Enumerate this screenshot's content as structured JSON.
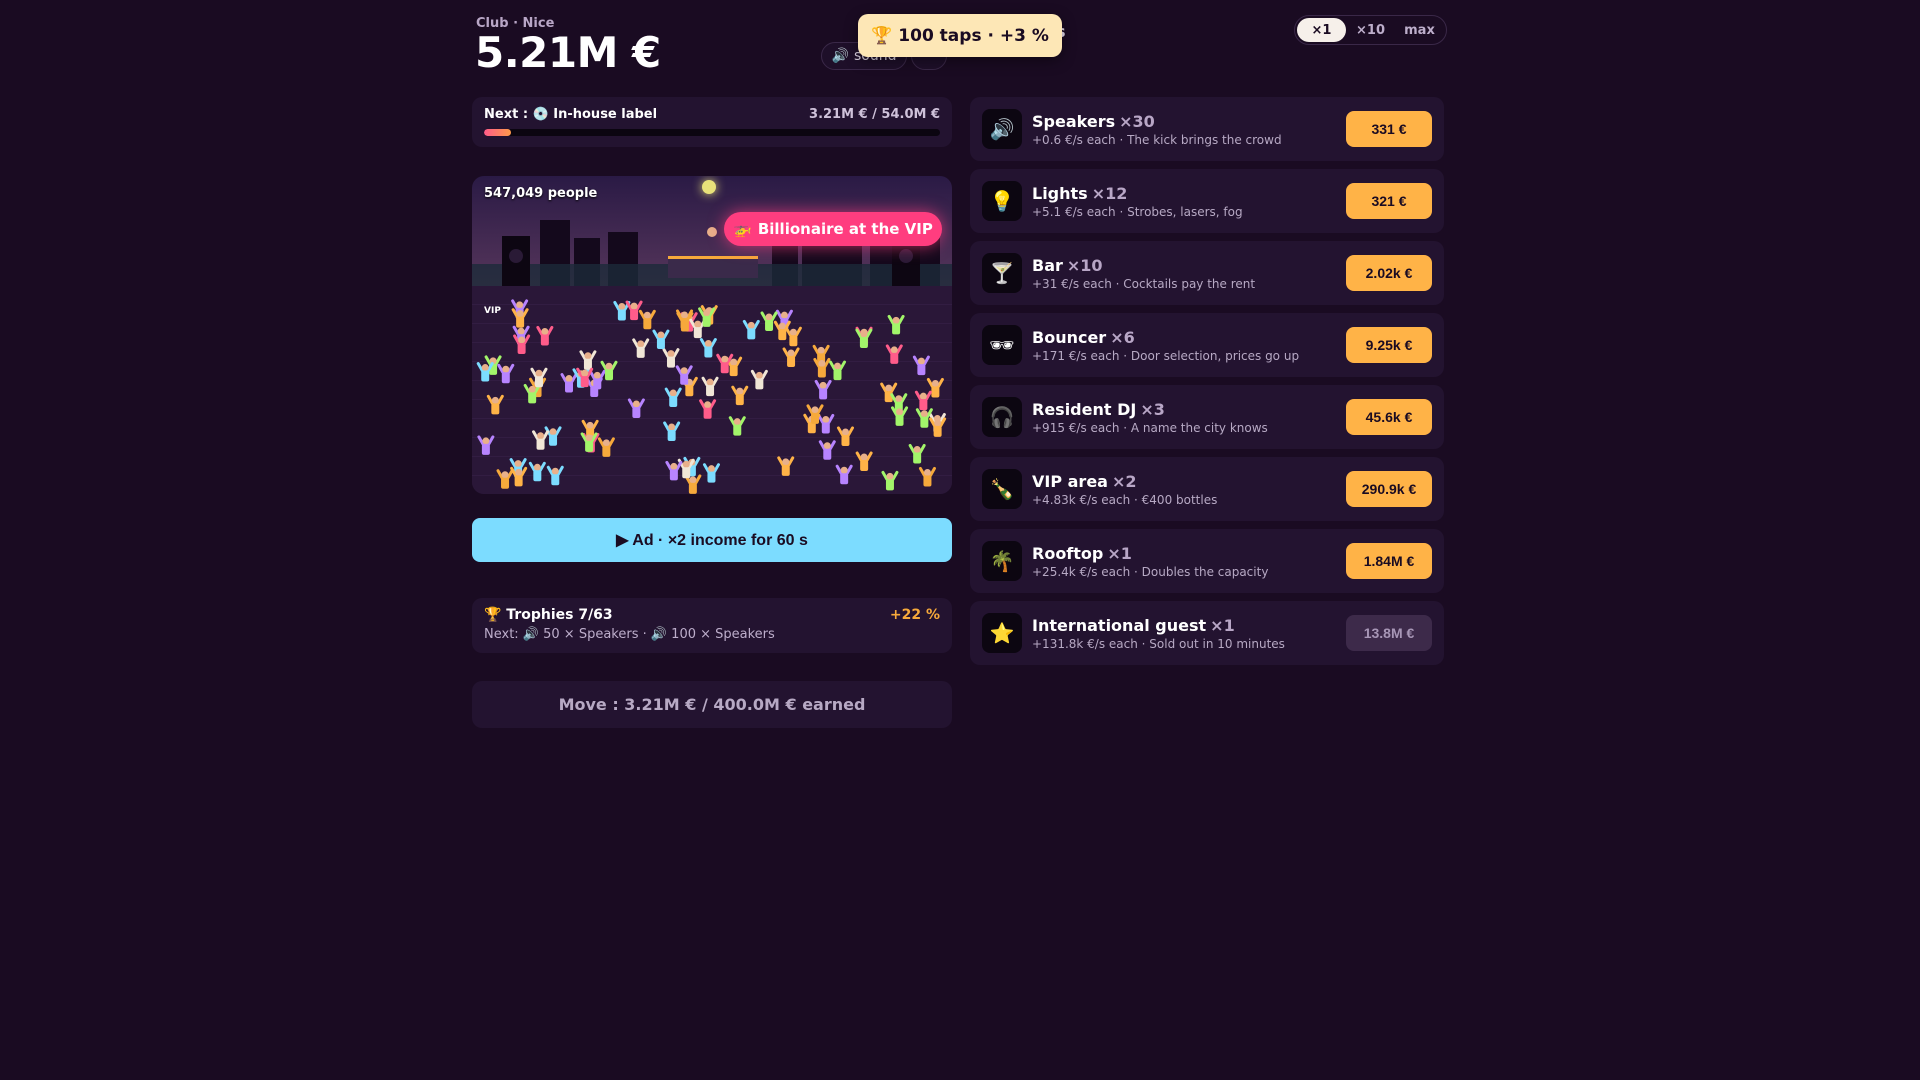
{
  "header": {
    "club": "Club · Nice",
    "money": "5.21M €",
    "sound_icon": "🔊",
    "sound_label": "sound",
    "more_label": "···",
    "toast_icon": "🏆",
    "toast_text": "100 taps · +3 %",
    "toast_edge": "s"
  },
  "multiplier": {
    "options": [
      "×1",
      "×10",
      "max"
    ],
    "active": "×1"
  },
  "next": {
    "label": "Next : 💿 In-house label",
    "amount": "3.21M € / 54.0M €",
    "progress": 0.06
  },
  "scene": {
    "people": "547,049 people",
    "event_icon": "🚁",
    "event": "Billionaire at the VIP",
    "vip": "VIP"
  },
  "ad": {
    "label": "▶ Ad · ×2 income for 60 s"
  },
  "trophies": {
    "title": "🏆 Trophies 7/63",
    "bonus": "+22 %",
    "next": "Next: 🔊 50 × Speakers · 🔊 100 × Speakers"
  },
  "move": {
    "label": "Move : 3.21M € / 400.0M € earned"
  },
  "upgrades": [
    {
      "icon": "🔊",
      "name": "Speakers",
      "count": "×30",
      "desc": "+0.6 €/s each · The kick brings the crowd",
      "price": "331 €",
      "affordable": true
    },
    {
      "icon": "💡",
      "name": "Lights",
      "count": "×12",
      "desc": "+5.1 €/s each · Strobes, lasers, fog",
      "price": "321 €",
      "affordable": true
    },
    {
      "icon": "🍸",
      "name": "Bar",
      "count": "×10",
      "desc": "+31 €/s each · Cocktails pay the rent",
      "price": "2.02k €",
      "affordable": true
    },
    {
      "icon": "🕶",
      "name": "Bouncer",
      "count": "×6",
      "desc": "+171 €/s each · Door selection, prices go up",
      "price": "9.25k €",
      "affordable": true
    },
    {
      "icon": "🎧",
      "name": "Resident DJ",
      "count": "×3",
      "desc": "+915 €/s each · A name the city knows",
      "price": "45.6k €",
      "affordable": true
    },
    {
      "icon": "🍾",
      "name": "VIP area",
      "count": "×2",
      "desc": "+4.83k €/s each · €400 bottles",
      "price": "290.9k €",
      "affordable": true
    },
    {
      "icon": "🌴",
      "name": "Rooftop",
      "count": "×1",
      "desc": "+25.4k €/s each · Doubles the capacity",
      "price": "1.84M €",
      "affordable": true
    },
    {
      "icon": "⭐",
      "name": "International guest",
      "count": "×1",
      "desc": "+131.8k €/s each · Sold out in 10 minutes",
      "price": "13.8M €",
      "affordable": false
    }
  ]
}
